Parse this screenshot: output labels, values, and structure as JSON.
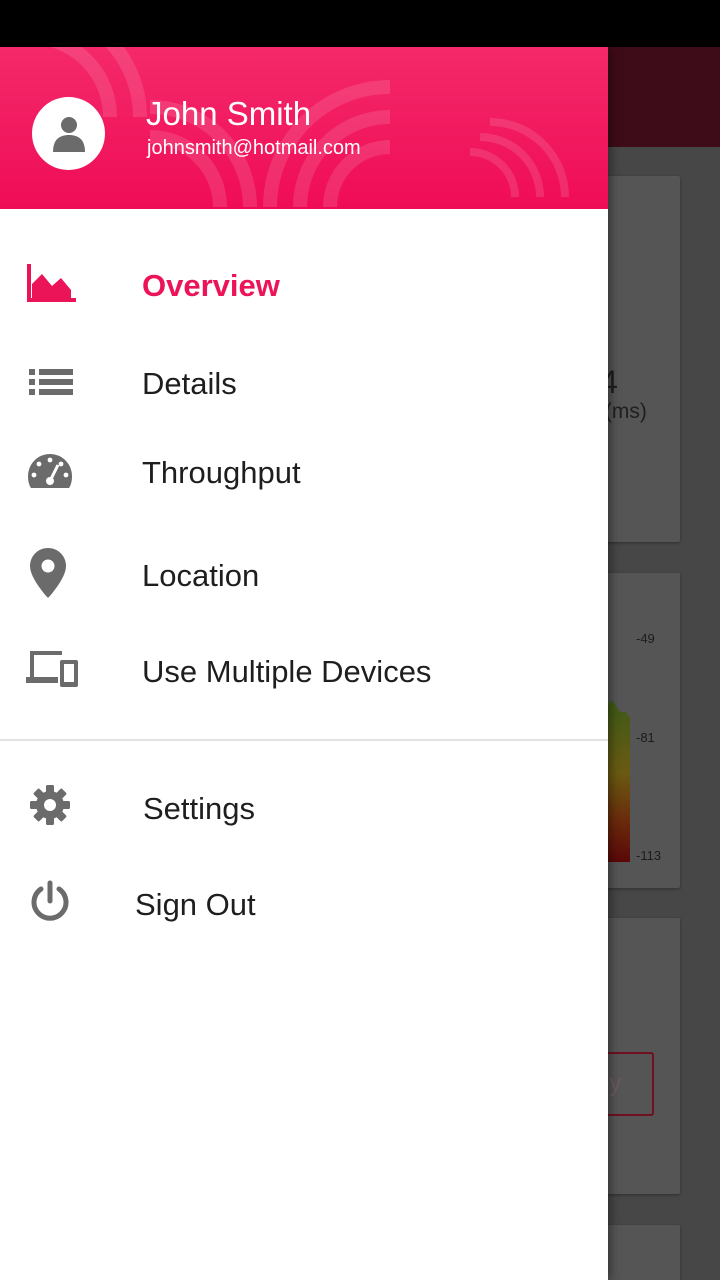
{
  "user": {
    "name": "John Smith",
    "email": "johnsmith@hotmail.com"
  },
  "menu": {
    "overview": {
      "label": "Overview",
      "icon": "area-chart-icon",
      "active": true
    },
    "details": {
      "label": "Details",
      "icon": "list-icon"
    },
    "throughput": {
      "label": "Throughput",
      "icon": "speedometer-icon"
    },
    "location": {
      "label": "Location",
      "icon": "location-pin-icon"
    },
    "devices": {
      "label": "Use Multiple Devices",
      "icon": "devices-icon"
    },
    "settings": {
      "label": "Settings",
      "icon": "gear-icon"
    },
    "signout": {
      "label": "Sign Out",
      "icon": "power-icon"
    }
  },
  "background": {
    "latency_value": "4",
    "latency_label": "r (ms)",
    "signal_ticks": [
      "-49",
      "-81",
      "-113"
    ],
    "button_text": "ey"
  },
  "colors": {
    "accent": "#ec1459",
    "header": "#ef0c56",
    "icon": "#6b6b6b"
  }
}
